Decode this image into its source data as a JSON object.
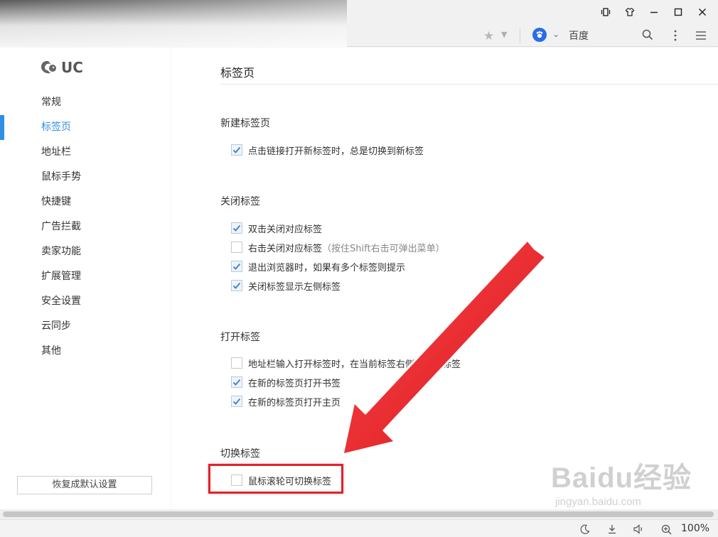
{
  "browser": {
    "search_engine": "百度",
    "zoom": "100%"
  },
  "sidebar": {
    "logo_text": "UC",
    "items": [
      {
        "label": "常规",
        "active": false
      },
      {
        "label": "标签页",
        "active": true
      },
      {
        "label": "地址栏",
        "active": false
      },
      {
        "label": "鼠标手势",
        "active": false
      },
      {
        "label": "快捷键",
        "active": false
      },
      {
        "label": "广告拦截",
        "active": false
      },
      {
        "label": "卖家功能",
        "active": false
      },
      {
        "label": "扩展管理",
        "active": false
      },
      {
        "label": "安全设置",
        "active": false
      },
      {
        "label": "云同步",
        "active": false
      },
      {
        "label": "其他",
        "active": false
      }
    ],
    "reset_label": "恢复成默认设置"
  },
  "content": {
    "page_title": "标签页",
    "sections": [
      {
        "title": "新建标签页",
        "options": [
          {
            "label": "点击链接打开新标签时，总是切换到新标签",
            "hint": "",
            "checked": true
          }
        ]
      },
      {
        "title": "关闭标签",
        "options": [
          {
            "label": "双击关闭对应标签",
            "hint": "",
            "checked": true
          },
          {
            "label": "右击关闭对应标签",
            "hint": "（按住Shift右击可弹出菜单）",
            "checked": false
          },
          {
            "label": "退出浏览器时，如果有多个标签则提示",
            "hint": "",
            "checked": true
          },
          {
            "label": "关闭标签显示左侧标签",
            "hint": "",
            "checked": true
          }
        ]
      },
      {
        "title": "打开标签",
        "options": [
          {
            "label": "地址栏输入打开标签时，在当前标签右侧打开新标签",
            "hint": "",
            "checked": false
          },
          {
            "label": "在新的标签页打开书签",
            "hint": "",
            "checked": true
          },
          {
            "label": "在新的标签页打开主页",
            "hint": "",
            "checked": true
          }
        ]
      },
      {
        "title": "切换标签",
        "options": [
          {
            "label": "鼠标滚轮可切换标签",
            "hint": "",
            "checked": false
          }
        ]
      }
    ]
  },
  "annotation": {
    "color": "#e3212a"
  },
  "watermark": {
    "brand": "Baidu经验",
    "url": "jingyan.baidu.com"
  }
}
